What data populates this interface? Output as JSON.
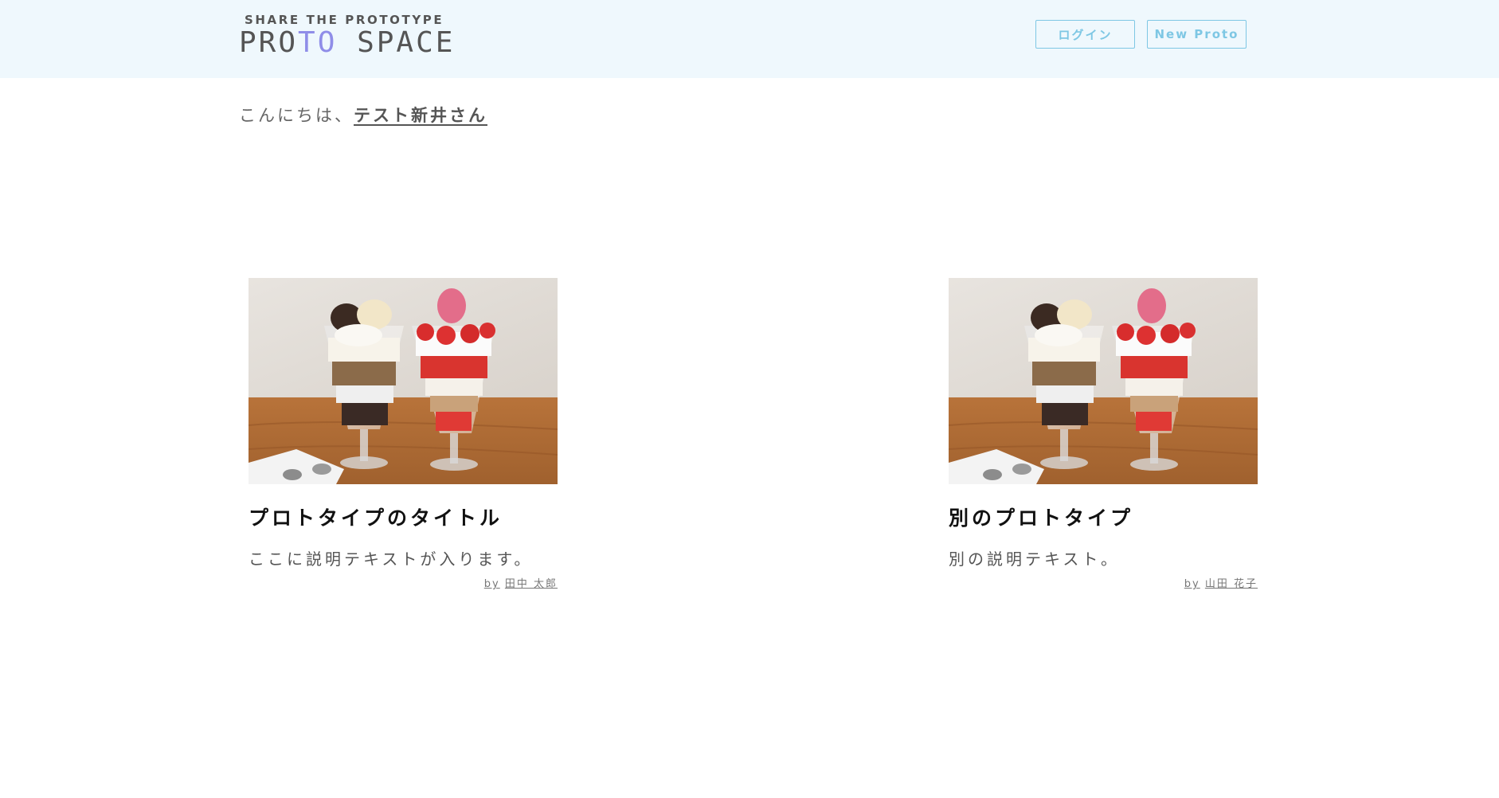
{
  "header": {
    "logo_sub": "SHARE THE PROTOTYPE",
    "logo_main_part1": "PRO",
    "logo_main_accent": "TO",
    "logo_main_part2": " SPACE",
    "login_label": "ログイン",
    "new_proto_label": "New Proto"
  },
  "greeting": {
    "prefix": "こんにちは、",
    "user_name": "テスト新井さん"
  },
  "prototypes": [
    {
      "title": "プロトタイプのタイトル",
      "description": "ここに説明テキストが入ります。",
      "by": "by",
      "author": "田中 太郎"
    },
    {
      "title": "別のプロトタイプ",
      "description": "別の説明テキスト。",
      "by": "by",
      "author": "山田 花子"
    }
  ],
  "colors": {
    "header_bg": "#eff8fd",
    "accent": "#8f8de8",
    "button": "#7ec7e4",
    "text": "#555555"
  }
}
